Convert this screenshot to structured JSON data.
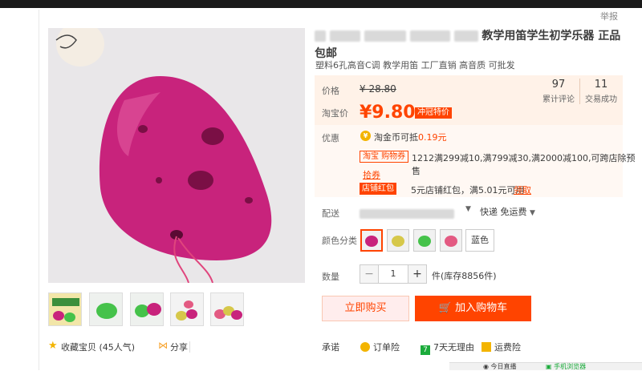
{
  "header": {
    "report_label": "举报"
  },
  "product": {
    "title_visible": "教学用笛学生初学乐器 正品",
    "title_line2": "包邮",
    "subtitle": "塑料6孔高音C调 教学用笛 工厂直销 高音质 可批发"
  },
  "price": {
    "price_label": "价格",
    "original_price": "¥ 28.80",
    "taobao_label": "淘宝价",
    "current_price": "¥9.80",
    "promo_badge": "冲冠特价"
  },
  "stats": [
    {
      "value": "97",
      "label": "累计评论"
    },
    {
      "value": "11",
      "label": "交易成功"
    }
  ],
  "promotions": {
    "label": "优惠",
    "coin_text": "淘金币可抵",
    "coin_amount": "0.19元",
    "coupon_tag": "淘宝 购物券",
    "coupon_text": "1212满299减10,满799减30,满2000减100,可跨店除预售",
    "get_coupon": "拾券",
    "shop_tag": "店铺红包",
    "shop_text": "5元店铺红包，满5.01元可用",
    "claim": "领取"
  },
  "shipping": {
    "label": "配送",
    "method": "快递 免运费"
  },
  "color": {
    "label": "颜色分类",
    "swatches": [
      "#c8237c",
      "#d6c84a",
      "#45c24a",
      "#e35a82"
    ],
    "text_option": "蓝色"
  },
  "quantity": {
    "label": "数量",
    "value": "1",
    "minus": "−",
    "plus": "+",
    "stock": "件(库存8856件)"
  },
  "actions": {
    "buy": "立即购买",
    "cart": "加入购物车"
  },
  "favorites": {
    "fav_text": "收藏宝贝 (45人气)",
    "share_text": "分享"
  },
  "promise": {
    "label": "承诺",
    "items": [
      {
        "text": "订单险",
        "color": "#f3b400",
        "glyph": "●"
      },
      {
        "text": "7天无理由",
        "color": "#1bab3b",
        "glyph": "7"
      },
      {
        "text": "运费险",
        "color": "#f3b400",
        "glyph": "■"
      }
    ]
  },
  "statusbar": {
    "live": "今日直播",
    "mobile": "手机浏览器"
  }
}
